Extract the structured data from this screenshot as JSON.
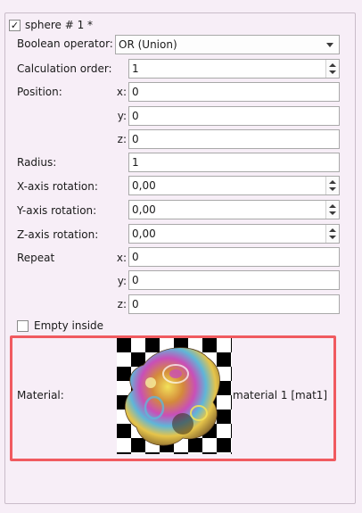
{
  "group": {
    "title": "sphere # 1 *",
    "enabled_check": "✓"
  },
  "boolean_operator": {
    "label": "Boolean operator:",
    "value": "OR (Union)"
  },
  "calculation_order": {
    "label": "Calculation order:",
    "value": "1"
  },
  "position": {
    "label": "Position:",
    "x_label": "x:",
    "x": "0",
    "y_label": "y:",
    "y": "0",
    "z_label": "z:",
    "z": "0"
  },
  "radius": {
    "label": "Radius:",
    "value": "1"
  },
  "rotation": {
    "x_label": "X-axis rotation:",
    "x": "0,00",
    "y_label": "Y-axis rotation:",
    "y": "0,00",
    "z_label": "Z-axis rotation:",
    "z": "0,00"
  },
  "repeat": {
    "label": "Repeat",
    "x_label": "x:",
    "x": "0",
    "y_label": "y:",
    "y": "0",
    "z_label": "z:",
    "z": "0"
  },
  "empty_inside": {
    "label": "Empty inside",
    "checked": false
  },
  "material": {
    "label": "Material:",
    "name": "material 1 [mat1]"
  },
  "colors": {
    "highlight_border": "#f05a60",
    "background": "#f7eef7"
  }
}
